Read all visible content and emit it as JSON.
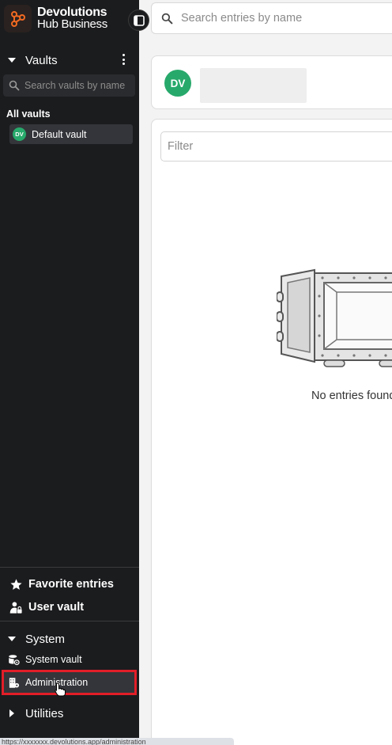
{
  "brand": {
    "line1": "Devolutions",
    "line2": "Hub Business"
  },
  "top_search": {
    "placeholder": "Search entries by name"
  },
  "vaults": {
    "title": "Vaults",
    "search_placeholder": "Search vaults by name",
    "group_label": "All vaults",
    "items": [
      {
        "initials": "DV",
        "name": "Default vault"
      }
    ]
  },
  "nav": {
    "favorites": "Favorite entries",
    "user_vault": "User vault"
  },
  "system": {
    "title": "System",
    "items": [
      {
        "label": "System vault",
        "icon": "database-gear-icon"
      },
      {
        "label": "Administration",
        "icon": "admin-building-icon"
      }
    ]
  },
  "utilities": {
    "title": "Utilities"
  },
  "main": {
    "vault_avatar": "DV",
    "filter_placeholder": "Filter",
    "empty_message": "No entries found"
  },
  "status_bar": {
    "url": "https://xxxxxxx.devolutions.app/administration"
  },
  "colors": {
    "sidebar_bg": "#1b1c1e",
    "accent_green": "#27a96b",
    "brand_orange": "#f26a21",
    "highlight_red": "#e21e28"
  }
}
